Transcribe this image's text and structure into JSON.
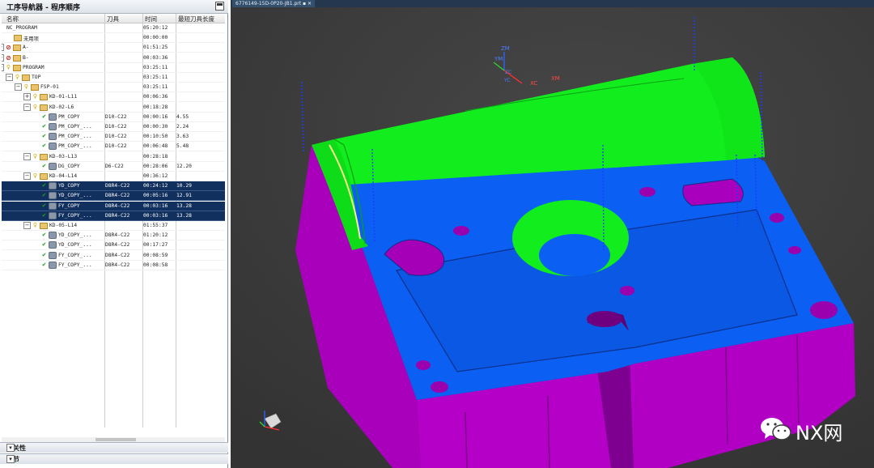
{
  "navigator": {
    "title": "工序导航器 - 程序顺序",
    "columns": {
      "name": "名称",
      "tool": "刀具",
      "time": "时间",
      "length": "最短刀具长度"
    },
    "rows": [
      {
        "name": "NC_PROGRAM",
        "level": 0,
        "time": "05:20:12",
        "tool": "",
        "length": "",
        "icons": []
      },
      {
        "name": "未用项",
        "level": 1,
        "time": "00:00:00",
        "tool": "",
        "length": "",
        "icons": [
          "folder"
        ]
      },
      {
        "name": "A-",
        "level": 0,
        "time": "01:51:25",
        "tool": "",
        "length": "",
        "icons": [
          "expand-plus",
          "banned",
          "folder"
        ]
      },
      {
        "name": "B-",
        "level": 0,
        "time": "00:03:36",
        "tool": "",
        "length": "",
        "icons": [
          "expand-plus",
          "banned",
          "folder"
        ]
      },
      {
        "name": "PROGRAM",
        "level": 0,
        "time": "03:25:11",
        "tool": "",
        "length": "",
        "icons": [
          "expand-minus",
          "key",
          "folder"
        ]
      },
      {
        "name": "TOP",
        "level": 1,
        "time": "03:25:11",
        "tool": "",
        "length": "",
        "icons": [
          "expand-minus",
          "key",
          "folder"
        ]
      },
      {
        "name": "FSP-01",
        "level": 2,
        "time": "03:25:11",
        "tool": "",
        "length": "",
        "icons": [
          "expand-minus",
          "key",
          "folder"
        ]
      },
      {
        "name": "KD-01-L11",
        "level": 3,
        "time": "00:06:36",
        "tool": "",
        "length": "",
        "icons": [
          "expand-plus",
          "key",
          "folder"
        ]
      },
      {
        "name": "KD-02-L6",
        "level": 3,
        "time": "00:18:28",
        "tool": "",
        "length": "",
        "icons": [
          "expand-minus",
          "key",
          "folder"
        ]
      },
      {
        "name": "PM_COPY",
        "level": 4,
        "time": "00:00:16",
        "tool": "D10-C22",
        "length": "4.55",
        "icons": [
          "check",
          "op"
        ]
      },
      {
        "name": "PM_COPY_...",
        "level": 4,
        "time": "00:00:30",
        "tool": "D10-C22",
        "length": "2.24",
        "icons": [
          "check",
          "op"
        ]
      },
      {
        "name": "PM_COPY_...",
        "level": 4,
        "time": "00:10:50",
        "tool": "D10-C22",
        "length": "3.63",
        "icons": [
          "check",
          "op"
        ]
      },
      {
        "name": "PM_COPY_...",
        "level": 4,
        "time": "00:06:48",
        "tool": "D10-C22",
        "length": "5.48",
        "icons": [
          "check",
          "op"
        ]
      },
      {
        "name": "KD-03-L13",
        "level": 3,
        "time": "00:28:18",
        "tool": "",
        "length": "",
        "icons": [
          "expand-minus",
          "key",
          "folder"
        ]
      },
      {
        "name": "DG_COPY",
        "level": 4,
        "time": "00:28:06",
        "tool": "D6-C22",
        "length": "12.20",
        "icons": [
          "check",
          "op"
        ]
      },
      {
        "name": "KD-04-L14",
        "level": 3,
        "time": "00:36:12",
        "tool": "",
        "length": "",
        "icons": [
          "expand-minus",
          "key",
          "folder"
        ]
      },
      {
        "name": "YD_COPY",
        "level": 4,
        "time": "00:24:12",
        "tool": "D8R4-C22",
        "length": "10.29",
        "icons": [
          "check",
          "op"
        ],
        "selected": true
      },
      {
        "name": "YD_COPY_...",
        "level": 4,
        "time": "00:05:16",
        "tool": "D8R4-C22",
        "length": "12.91",
        "icons": [
          "check",
          "op"
        ],
        "selected": true
      },
      {
        "name": "FY_COPY",
        "level": 4,
        "time": "00:03:16",
        "tool": "D8R4-C22",
        "length": "13.28",
        "icons": [
          "check",
          "op"
        ],
        "selected": true
      },
      {
        "name": "FY_COPY_...",
        "level": 4,
        "time": "00:03:16",
        "tool": "D8R4-C22",
        "length": "13.28",
        "icons": [
          "check",
          "op"
        ],
        "selected": true
      },
      {
        "name": "KD-05-L14",
        "level": 3,
        "time": "01:55:37",
        "tool": "",
        "length": "",
        "icons": [
          "expand-minus",
          "key",
          "folder"
        ]
      },
      {
        "name": "YD_COPY_...",
        "level": 4,
        "time": "01:20:12",
        "tool": "D8R4-C22",
        "length": "",
        "icons": [
          "check",
          "op"
        ]
      },
      {
        "name": "YD_COPY_...",
        "level": 4,
        "time": "00:17:27",
        "tool": "D8R4-C22",
        "length": "",
        "icons": [
          "check",
          "op"
        ]
      },
      {
        "name": "FY_COPY_...",
        "level": 4,
        "time": "00:08:59",
        "tool": "D8R4-C22",
        "length": "",
        "icons": [
          "check",
          "op"
        ]
      },
      {
        "name": "FY_COPY_...",
        "level": 4,
        "time": "00:08:58",
        "tool": "D8R4-C22",
        "length": "",
        "icons": [
          "check",
          "op"
        ]
      }
    ],
    "sections": [
      {
        "label": "相关性",
        "icon": "chevron-down-icon"
      },
      {
        "label": "细节",
        "icon": "chevron-down-icon"
      }
    ]
  },
  "viewport": {
    "tab_label": "6776149-15D-0P20-JB1.prt",
    "axis_labels": {
      "zm": "ZM",
      "ym": "YM",
      "xm": "XM",
      "xc": "XC",
      "zc": "ZC",
      "yc": "YC"
    },
    "colors": {
      "background": "#3b3b3b",
      "top_face": "#0a5ff0",
      "side_face": "#b300c4",
      "machined_face": "#12ee1d",
      "toolpath": "#1840ff",
      "selection": "#12305e"
    }
  },
  "watermark": {
    "text": "NX网",
    "icon": "wechat-icon"
  }
}
